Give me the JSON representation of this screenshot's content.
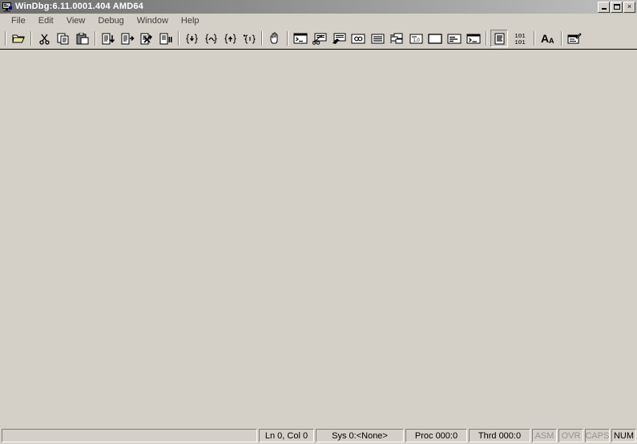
{
  "window": {
    "title": "WinDbg:6.11.0001.404 AMD64",
    "app_icon": "debugger-monitor-icon",
    "minimize_label": "Minimize",
    "maximize_label": "Restore",
    "close_label": "×",
    "titlebar_gradient_start": "#6e6e6e",
    "titlebar_gradient_end": "#c0c0c0",
    "face_color": "#d4d0c8"
  },
  "menu": {
    "items": [
      {
        "label": "File"
      },
      {
        "label": "Edit"
      },
      {
        "label": "View"
      },
      {
        "label": "Debug"
      },
      {
        "label": "Window"
      },
      {
        "label": "Help"
      }
    ]
  },
  "toolbar": {
    "groups": [
      {
        "buttons": [
          {
            "name": "open-file-button",
            "icon": "open-folder-icon",
            "pressed": false
          }
        ]
      },
      {
        "buttons": [
          {
            "name": "cut-button",
            "icon": "scissors-icon",
            "pressed": false
          },
          {
            "name": "copy-button",
            "icon": "copy-icon",
            "pressed": false
          },
          {
            "name": "paste-button",
            "icon": "paste-icon",
            "pressed": false
          }
        ]
      },
      {
        "buttons": [
          {
            "name": "go-button",
            "icon": "list-run-icon",
            "pressed": false
          },
          {
            "name": "restart-button",
            "icon": "list-restart-icon",
            "pressed": false
          },
          {
            "name": "stop-debugging-button",
            "icon": "list-stop-icon",
            "pressed": false
          },
          {
            "name": "break-button",
            "icon": "list-break-icon",
            "pressed": false
          }
        ]
      },
      {
        "buttons": [
          {
            "name": "step-into-button",
            "icon": "brace-step-into-icon",
            "pressed": false
          },
          {
            "name": "step-over-button",
            "icon": "brace-step-over-icon",
            "pressed": false
          },
          {
            "name": "step-out-button",
            "icon": "brace-step-out-icon",
            "pressed": false
          },
          {
            "name": "run-to-cursor-button",
            "icon": "brace-run-to-cursor-icon",
            "pressed": false
          }
        ]
      },
      {
        "buttons": [
          {
            "name": "break-hand-button",
            "icon": "hand-icon",
            "pressed": false
          }
        ]
      },
      {
        "buttons": [
          {
            "name": "command-window-button",
            "icon": "command-prompt-icon",
            "pressed": false
          },
          {
            "name": "watch-window-button",
            "icon": "watch-window-icon",
            "pressed": false
          },
          {
            "name": "locals-window-button",
            "icon": "locals-window-icon",
            "pressed": false
          },
          {
            "name": "registers-window-button",
            "icon": "registers-window-icon",
            "pressed": false
          },
          {
            "name": "memory-window-button",
            "icon": "memory-list-icon",
            "pressed": false
          },
          {
            "name": "processes-threads-button",
            "icon": "processes-threads-icon",
            "pressed": false
          },
          {
            "name": "call-stack-button",
            "icon": "call-stack-icon",
            "label": "1.0",
            "pressed": false
          },
          {
            "name": "disassembly-window-button",
            "icon": "blank-window-icon",
            "pressed": false
          },
          {
            "name": "scratch-pad-button",
            "icon": "scratch-pad-icon",
            "pressed": false
          },
          {
            "name": "shell-window-button",
            "icon": "shell-window-icon",
            "pressed": false
          }
        ]
      },
      {
        "buttons": [
          {
            "name": "source-mode-button",
            "icon": "source-document-icon",
            "pressed": true
          },
          {
            "name": "assembly-mode-button",
            "icon": "binary-101-icon",
            "label_top": "101",
            "label_bottom": "101",
            "pressed": false
          }
        ]
      },
      {
        "buttons": [
          {
            "name": "font-button",
            "icon": "font-aa-icon",
            "label": "A",
            "label_small": "A",
            "pressed": false
          }
        ]
      },
      {
        "buttons": [
          {
            "name": "notes-button",
            "icon": "notes-pencil-icon",
            "pressed": false
          }
        ]
      }
    ]
  },
  "client": {
    "content": ""
  },
  "statusbar": {
    "message": "",
    "panes": [
      {
        "name": "status-line-col",
        "text": "Ln 0, Col 0",
        "enabled": true,
        "width_class": "s-ln"
      },
      {
        "name": "status-system",
        "text": "Sys 0:<None>",
        "enabled": true,
        "width_class": "s-sys"
      },
      {
        "name": "status-process",
        "text": "Proc 000:0",
        "enabled": true,
        "width_class": "s-proc"
      },
      {
        "name": "status-thread",
        "text": "Thrd 000:0",
        "enabled": true,
        "width_class": "s-thrd"
      },
      {
        "name": "status-asm",
        "text": "ASM",
        "enabled": false,
        "width_class": "s-flag"
      },
      {
        "name": "status-ovr",
        "text": "OVR",
        "enabled": false,
        "width_class": "s-flag"
      },
      {
        "name": "status-caps",
        "text": "CAPS",
        "enabled": false,
        "width_class": "s-flag"
      },
      {
        "name": "status-num",
        "text": "NUM",
        "enabled": true,
        "width_class": "s-flag"
      }
    ]
  }
}
